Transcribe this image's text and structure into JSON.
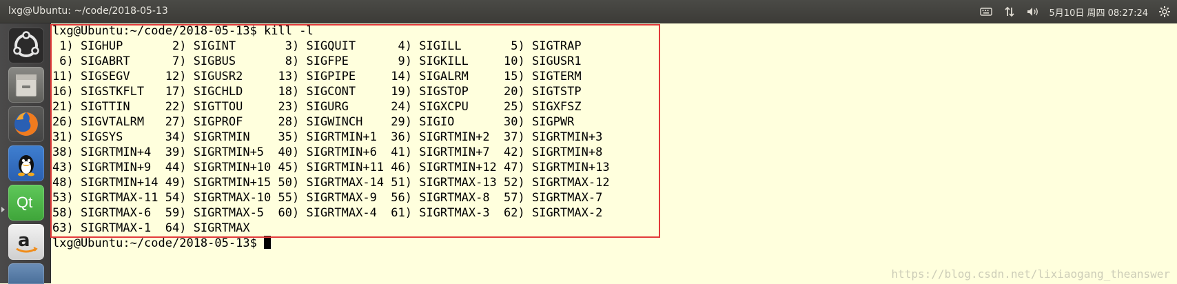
{
  "window": {
    "title": "lxg@Ubuntu: ~/code/2018-05-13"
  },
  "tray": {
    "clock": "5月10日 周四 08:27:24"
  },
  "launcher": {
    "items": [
      {
        "name": "ubuntu-dash-icon",
        "label": "Dash"
      },
      {
        "name": "files-icon",
        "label": "Files"
      },
      {
        "name": "firefox-icon",
        "label": "Firefox"
      },
      {
        "name": "qq-icon",
        "label": "QQ"
      },
      {
        "name": "qt-icon",
        "label": "Qt"
      },
      {
        "name": "amazon-icon",
        "label": "Amazon"
      }
    ],
    "qt_label": "Qt"
  },
  "terminal": {
    "lines": [
      "lxg@Ubuntu:~/code/2018-05-13$ kill -l",
      " 1) SIGHUP       2) SIGINT       3) SIGQUIT      4) SIGILL       5) SIGTRAP",
      " 6) SIGABRT      7) SIGBUS       8) SIGFPE       9) SIGKILL     10) SIGUSR1",
      "11) SIGSEGV     12) SIGUSR2     13) SIGPIPE     14) SIGALRM     15) SIGTERM",
      "16) SIGSTKFLT   17) SIGCHLD     18) SIGCONT     19) SIGSTOP     20) SIGTSTP",
      "21) SIGTTIN     22) SIGTTOU     23) SIGURG      24) SIGXCPU     25) SIGXFSZ",
      "26) SIGVTALRM   27) SIGPROF     28) SIGWINCH    29) SIGIO       30) SIGPWR",
      "31) SIGSYS      34) SIGRTMIN    35) SIGRTMIN+1  36) SIGRTMIN+2  37) SIGRTMIN+3",
      "38) SIGRTMIN+4  39) SIGRTMIN+5  40) SIGRTMIN+6  41) SIGRTMIN+7  42) SIGRTMIN+8",
      "43) SIGRTMIN+9  44) SIGRTMIN+10 45) SIGRTMIN+11 46) SIGRTMIN+12 47) SIGRTMIN+13",
      "48) SIGRTMIN+14 49) SIGRTMIN+15 50) SIGRTMAX-14 51) SIGRTMAX-13 52) SIGRTMAX-12",
      "53) SIGRTMAX-11 54) SIGRTMAX-10 55) SIGRTMAX-9  56) SIGRTMAX-8  57) SIGRTMAX-7",
      "58) SIGRTMAX-6  59) SIGRTMAX-5  60) SIGRTMAX-4  61) SIGRTMAX-3  62) SIGRTMAX-2",
      "63) SIGRTMAX-1  64) SIGRTMAX"
    ],
    "prompt": "lxg@Ubuntu:~/code/2018-05-13$ "
  },
  "watermark": "https://blog.csdn.net/lixiaogang_theanswer",
  "colors": {
    "terminal_bg": "#ffffdd",
    "highlight_border": "#e23a3a",
    "panel_bg": "#3c3b37"
  }
}
